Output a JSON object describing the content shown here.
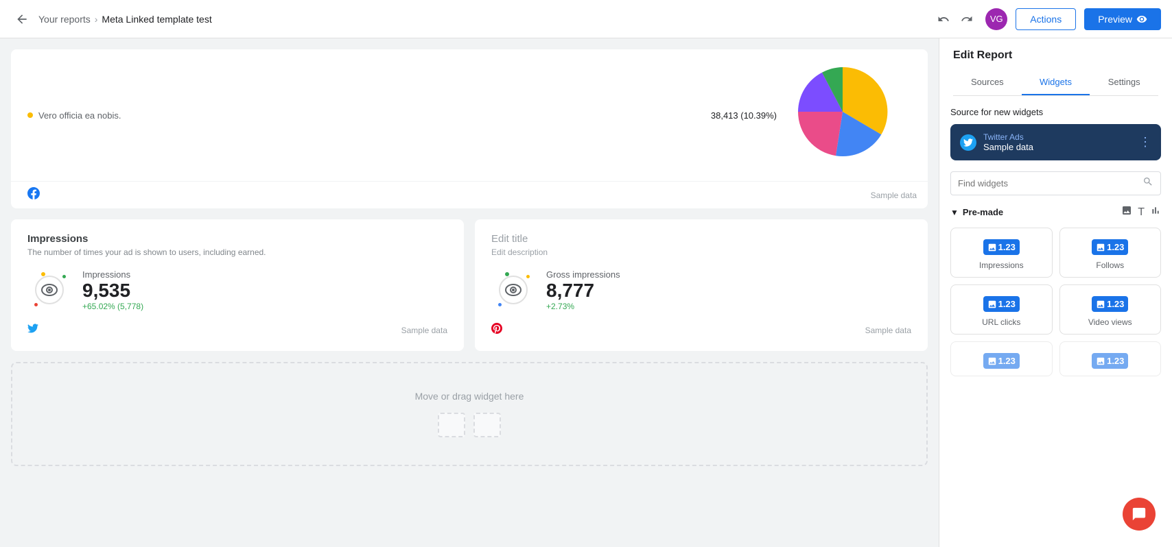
{
  "topbar": {
    "back_label": "←",
    "breadcrumb_link": "Your reports",
    "breadcrumb_sep": "›",
    "breadcrumb_current": "Meta Linked template test",
    "avatar_initials": "VG",
    "actions_label": "Actions",
    "preview_label": "Preview"
  },
  "canvas": {
    "legend_item_text": "Vero officia ea nobis.",
    "legend_item_value": "38,413 (10.39%)",
    "sample_data_label": "Sample data",
    "facebook_icon": "f",
    "card1": {
      "title": "Impressions",
      "description": "The number of times your ad is shown to users, including earned.",
      "metric_name": "Impressions",
      "metric_value": "9,535",
      "metric_change": "+65.02% (5,778)",
      "sample_data": "Sample data",
      "platform_icon": "twitter"
    },
    "card2": {
      "title": "Edit title",
      "description": "Edit description",
      "metric_name": "Gross impressions",
      "metric_value": "8,777",
      "metric_change": "+2.73%",
      "sample_data": "Sample data",
      "platform_icon": "pinterest"
    },
    "dropzone_text": "Move or drag widget here"
  },
  "right_panel": {
    "title": "Edit Report",
    "tabs": [
      {
        "label": "Sources",
        "active": false
      },
      {
        "label": "Widgets",
        "active": true
      },
      {
        "label": "Settings",
        "active": false
      }
    ],
    "source_for_new_widgets": "Source for new widgets",
    "source_platform": "Twitter Ads",
    "source_name": "Sample data",
    "source_menu": "⋮",
    "find_widgets_placeholder": "Find widgets",
    "premade_label": "Pre-made",
    "premade_chevron": "∨",
    "widgets": [
      {
        "label": "Impressions"
      },
      {
        "label": "Follows"
      },
      {
        "label": "URL clicks"
      },
      {
        "label": "Video views"
      },
      {
        "label": ""
      },
      {
        "label": ""
      }
    ],
    "widget_number": "1.23"
  }
}
